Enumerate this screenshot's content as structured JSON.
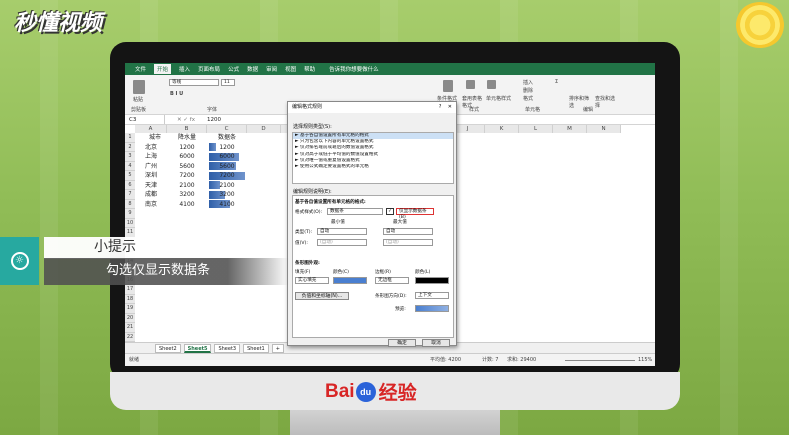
{
  "watermark": {
    "logo_text": "秒懂视频",
    "brand": "Bai",
    "paw": "du",
    "brand_suffix": "经验"
  },
  "excel": {
    "tabs": [
      "文件",
      "开始",
      "插入",
      "页面布局",
      "公式",
      "数据",
      "审阅",
      "视图",
      "帮助"
    ],
    "active_tab": "开始",
    "tell_me": "告诉我你想要做什么",
    "ribbon": {
      "paste": "粘贴",
      "clipboard": "剪贴板",
      "font": "字体",
      "font_name": "等线",
      "font_size": "11",
      "conditional": "条件格式",
      "table_fmt": "套用表格格式",
      "cell_style": "单元格样式",
      "style": "样式",
      "insert": "插入",
      "delete": "删除",
      "format": "格式",
      "cells": "单元格",
      "sort": "排序和筛选",
      "find": "查找和选择",
      "editing": "编辑"
    },
    "namebox": "C3",
    "formula": "1200",
    "columns": [
      "A",
      "B",
      "C",
      "D",
      "E",
      "F",
      "G",
      "H",
      "I",
      "J",
      "K",
      "L",
      "M",
      "N"
    ],
    "rows": [
      "1",
      "2",
      "3",
      "4",
      "5",
      "6",
      "7",
      "8",
      "9",
      "10",
      "11",
      "12",
      "13",
      "14",
      "15",
      "16",
      "17",
      "18",
      "19",
      "20",
      "21",
      "22",
      "23",
      "24",
      "25",
      "26",
      "27",
      "28"
    ],
    "table": {
      "headers": [
        "城市",
        "降水量",
        "数据条"
      ],
      "data": [
        {
          "city": "北京",
          "rain": "1200",
          "bar": "1200",
          "level": 0.2
        },
        {
          "city": "上海",
          "rain": "6000",
          "bar": "6000",
          "level": 0.82
        },
        {
          "city": "广州",
          "rain": "5600",
          "bar": "5600",
          "level": 0.76
        },
        {
          "city": "深圳",
          "rain": "7200",
          "bar": "7200",
          "level": 1.0
        },
        {
          "city": "天津",
          "rain": "2100",
          "bar": "2100",
          "level": 0.3
        },
        {
          "city": "成都",
          "rain": "3200",
          "bar": "3200",
          "level": 0.45
        },
        {
          "city": "南京",
          "rain": "4100",
          "bar": "4100",
          "level": 0.57
        }
      ]
    },
    "sheets": [
      "Sheet2",
      "Sheet5",
      "Sheet3",
      "Sheet1"
    ],
    "active_sheet": "Sheet5",
    "status": {
      "mode": "就绪",
      "avg": "平均值: 4200",
      "count": "计数: 7",
      "sum": "求和: 29400",
      "zoom": "115%"
    }
  },
  "dialog": {
    "title": "编辑格式规则",
    "help": "?",
    "close": "✕",
    "select_rule_type": "选择规则类型(S):",
    "rule_types": [
      "► 基于各自值设置所有单元格的格式",
      "► 只为包含以下内容的单元格设置格式",
      "► 仅对排名靠前或靠后的数值设置格式",
      "► 仅对高于或低于平均值的数值设置格式",
      "► 仅对唯一值或重复值设置格式",
      "► 使用公式确定要设置格式的单元格"
    ],
    "edit_rule_desc": "编辑规则说明(E):",
    "based_on": "基于各自值设置所有单元格的格式:",
    "format_style_label": "格式样式(O):",
    "format_style": "数据条",
    "show_bar_only": "仅显示数据条(B)",
    "min": "最小值",
    "max": "最大值",
    "type_label": "类型(T):",
    "value_label": "值(V):",
    "min_type": "自动",
    "max_type": "自动",
    "min_value": "(自动)",
    "max_value": "(自动)",
    "bar_appearance": "条形图外观:",
    "fill_label": "填充(F)",
    "color_label": "颜色(C)",
    "border_label": "边框(R)",
    "color2_label": "颜色(L)",
    "fill": "实心填充",
    "border": "无边框",
    "neg_axis": "负值和坐标轴(N)...",
    "bar_direction_label": "条形图方向(D):",
    "bar_direction": "上下文",
    "preview": "预览:",
    "ok": "确定",
    "cancel": "取消",
    "fill_color": "#4a7fd0",
    "border_color": "#000000"
  },
  "hint": {
    "title": "小提示",
    "text": "勾选仅显示数据条"
  }
}
